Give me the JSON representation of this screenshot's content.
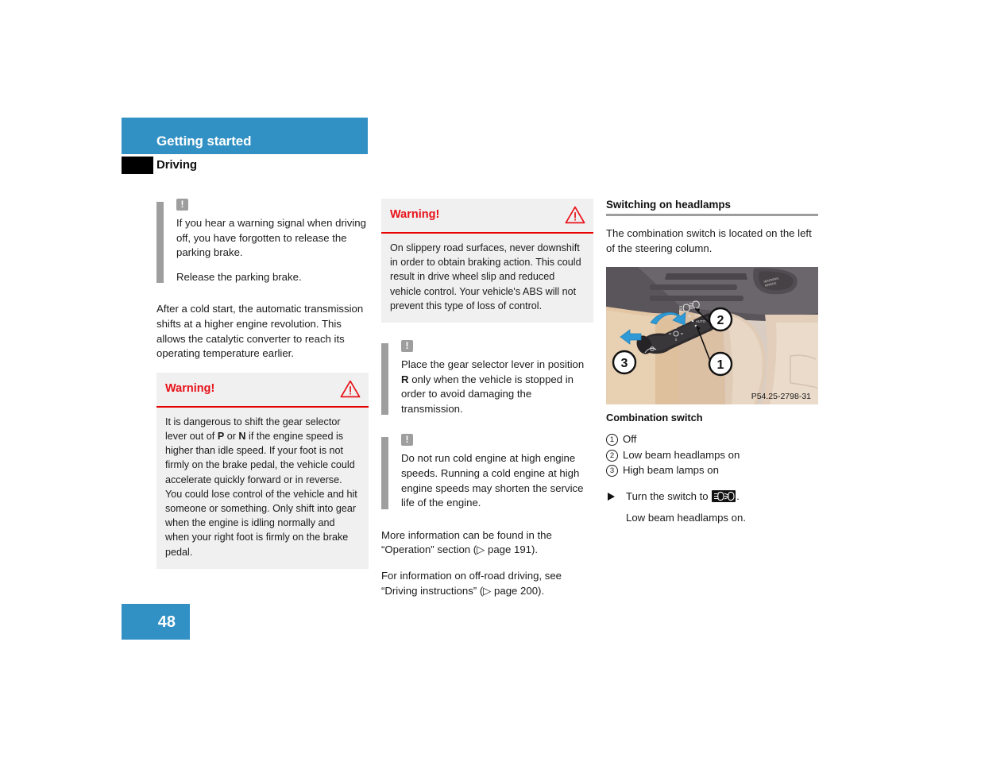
{
  "header": {
    "section_title": "Getting started",
    "sub_title": "Driving",
    "band_color": "#3191c4"
  },
  "footer": {
    "page_number": "48",
    "tab_color": "#3191c4"
  },
  "column1": {
    "note1": {
      "icon": "note-exclamation-icon",
      "paragraph1": "If you hear a warning signal when driving off, you have forgotten to release the parking brake.",
      "paragraph2": "Release the parking brake."
    },
    "paragraph1": "After a cold start, the automatic transmission shifts at a higher engine revolution. This allows the catalytic converter to reach its operating temperature earlier.",
    "warning": {
      "title": "Warning!",
      "icon": "warning-triangle-icon",
      "body_prefix": "It is dangerous to shift the gear selector lever out of ",
      "gear_p": "P",
      "body_mid": " or ",
      "gear_n": "N",
      "body_suffix": " if the engine speed is higher than idle speed. If your foot is not firmly on the brake pedal, the vehicle could accelerate quickly forward or in reverse. You could lose control of the vehicle and hit someone or something. Only shift into gear when the engine is idling normally and when your right foot is firmly on the brake pedal."
    }
  },
  "column2": {
    "warning": {
      "title": "Warning!",
      "icon": "warning-triangle-icon",
      "body": "On slippery road surfaces, never downshift in order to obtain braking action. This could result in drive wheel slip and reduced vehicle control. Your vehicle's ABS will not prevent this type of loss of control."
    },
    "note1": {
      "icon": "note-exclamation-icon",
      "body_prefix": "Place the gear selector lever in position ",
      "gear_r": "R",
      "body_suffix": " only when the vehicle is stopped in order to avoid damaging the transmission."
    },
    "note2": {
      "icon": "note-exclamation-icon",
      "body": "Do not run cold engine at high engine speeds. Running a cold engine at high engine speeds may shorten the service life of the engine."
    },
    "paragraph1": "More information can be found in the “Operation” section (▷ page 191).",
    "paragraph2": "For information on off-road driving, see “Driving instructions” (▷ page 200)."
  },
  "column3": {
    "section_heading": "Switching on headlamps",
    "intro": "The combination switch is located on the left of the steering column.",
    "figure": {
      "name": "combination-switch-photo",
      "reference_code": "P54.25-2798-31",
      "callouts": [
        "1",
        "2",
        "3"
      ]
    },
    "figure_caption": "Combination switch",
    "legend": [
      {
        "num": "1",
        "label": "Off"
      },
      {
        "num": "2",
        "label": "Low beam headlamps on"
      },
      {
        "num": "3",
        "label": "High beam lamps on"
      }
    ],
    "step": {
      "bullet": "triangle-bullet-icon",
      "text_prefix": "Turn the switch to ",
      "glyph": "low-beam-headlamp-icon",
      "text_suffix": "."
    },
    "step_result": "Low beam headlamps on."
  }
}
